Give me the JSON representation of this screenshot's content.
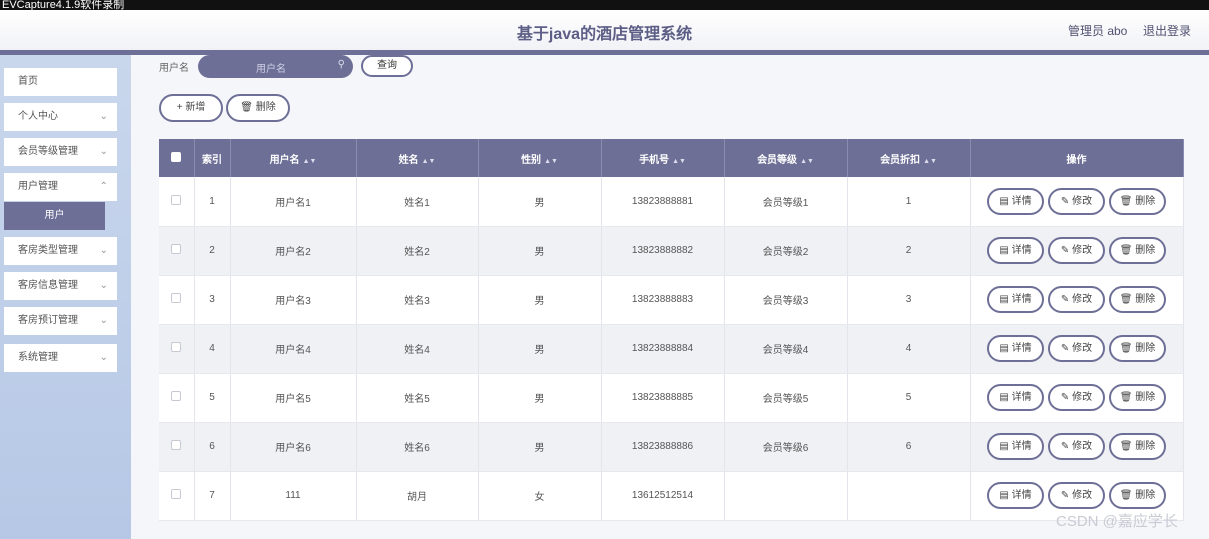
{
  "recorder": {
    "title": "EVCapture4.1.9软件录制"
  },
  "header": {
    "title": "基于java的酒店管理系统",
    "admin": "管理员 abo",
    "logout": "退出登录"
  },
  "sidebar": {
    "items": [
      {
        "label": "首页",
        "chevron": ""
      },
      {
        "label": "个人中心",
        "chevron": "⌄"
      },
      {
        "label": "会员等级管理",
        "chevron": "⌄"
      },
      {
        "label": "用户管理",
        "chevron": "⌄"
      },
      {
        "label": "客房类型管理",
        "chevron": "⌄"
      },
      {
        "label": "客房信息管理",
        "chevron": "⌄"
      },
      {
        "label": "客房预订管理",
        "chevron": "⌄"
      },
      {
        "label": "系统管理",
        "chevron": "⌄"
      }
    ],
    "active_sub": "用户"
  },
  "search": {
    "label": "用户名",
    "placeholder": "用户名",
    "query_label": "查询"
  },
  "toolbar": {
    "add_label": "新增",
    "delete_label": "删除"
  },
  "table": {
    "headers": [
      "索引",
      "用户名",
      "姓名",
      "性别",
      "手机号",
      "会员等级",
      "会员折扣",
      "操作"
    ],
    "actions": {
      "detail": "详情",
      "edit": "修改",
      "delete": "删除"
    },
    "rows": [
      {
        "index": "1",
        "username": "用户名1",
        "name": "姓名1",
        "gender": "男",
        "phone": "13823888881",
        "level": "会员等级1",
        "discount": "1"
      },
      {
        "index": "2",
        "username": "用户名2",
        "name": "姓名2",
        "gender": "男",
        "phone": "13823888882",
        "level": "会员等级2",
        "discount": "2"
      },
      {
        "index": "3",
        "username": "用户名3",
        "name": "姓名3",
        "gender": "男",
        "phone": "13823888883",
        "level": "会员等级3",
        "discount": "3"
      },
      {
        "index": "4",
        "username": "用户名4",
        "name": "姓名4",
        "gender": "男",
        "phone": "13823888884",
        "level": "会员等级4",
        "discount": "4"
      },
      {
        "index": "5",
        "username": "用户名5",
        "name": "姓名5",
        "gender": "男",
        "phone": "13823888885",
        "level": "会员等级5",
        "discount": "5"
      },
      {
        "index": "6",
        "username": "用户名6",
        "name": "姓名6",
        "gender": "男",
        "phone": "13823888886",
        "level": "会员等级6",
        "discount": "6"
      },
      {
        "index": "7",
        "username": "111",
        "name": "胡月",
        "gender": "女",
        "phone": "13612512514",
        "level": "",
        "discount": ""
      }
    ]
  },
  "watermark": "CSDN @嘉应学长"
}
